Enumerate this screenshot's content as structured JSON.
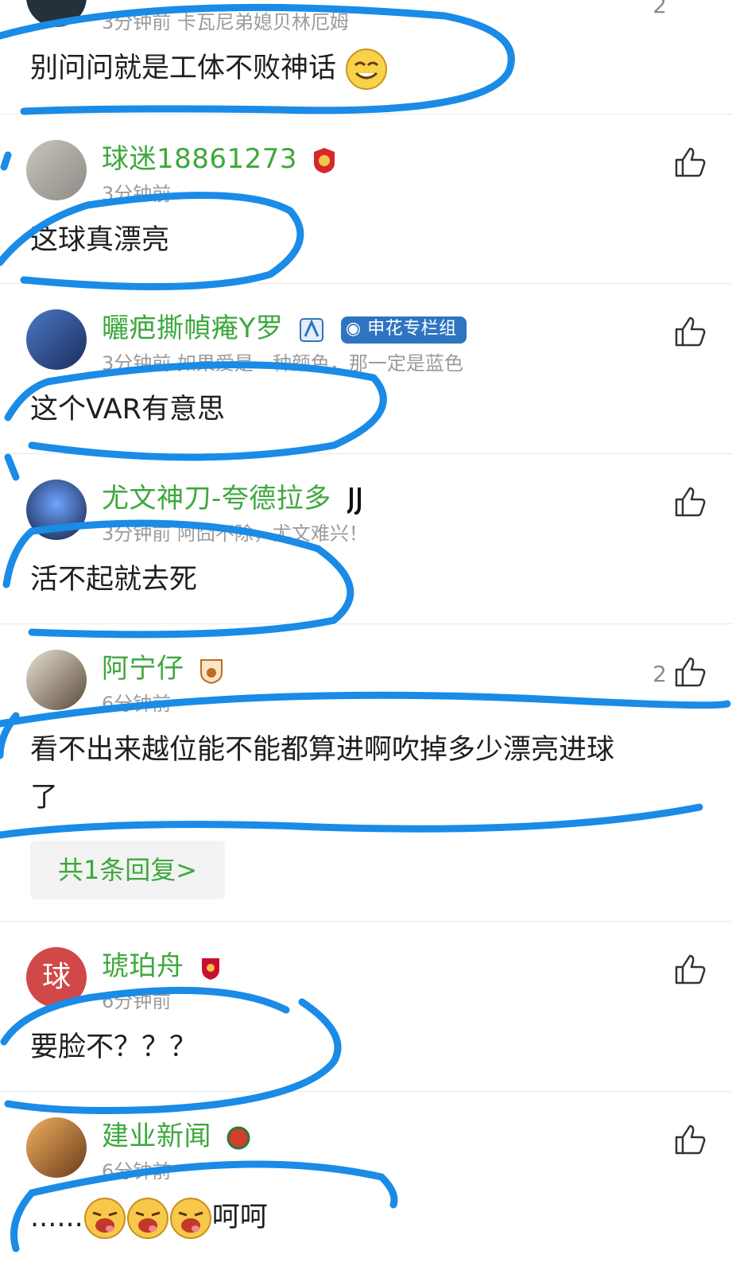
{
  "comments": [
    {
      "text": "别问问就是工体不败神话",
      "meta": "3分钟前 卡瓦尼弟媳贝林厄姆",
      "like_count": "2"
    },
    {
      "name": "球迷18861273",
      "meta": "3分钟前",
      "text": "这球真漂亮"
    },
    {
      "name": "曬疤撕幀痷Y罗",
      "tag": "申花专栏组",
      "meta": "3分钟前 如果爱是一种颜色，那一定是蓝色",
      "text": "这个VAR有意思"
    },
    {
      "name": "尤文神刀-夸德拉多",
      "meta": "3分钟前 阿囧不除，尤文难兴！",
      "text": "活不起就去死"
    },
    {
      "name": "阿宁仔",
      "meta": "6分钟前",
      "text_line1": "看不出来越位能不能都算进啊吹掉多少漂亮进球",
      "text_line2": "了",
      "like_count": "2",
      "reply": "共1条回复>"
    },
    {
      "name": "琥珀舟",
      "avatar_char": "球",
      "meta": "6分钟前",
      "text": "要脸不？？？"
    },
    {
      "name": "建业新闻",
      "meta": "6分钟前",
      "text_prefix": "......",
      "text_suffix": "呵呵"
    }
  ],
  "colors": {
    "name_green": "#3da83d",
    "scribble_blue": "#1a8be6",
    "meta_gray": "#9b9b9b"
  }
}
